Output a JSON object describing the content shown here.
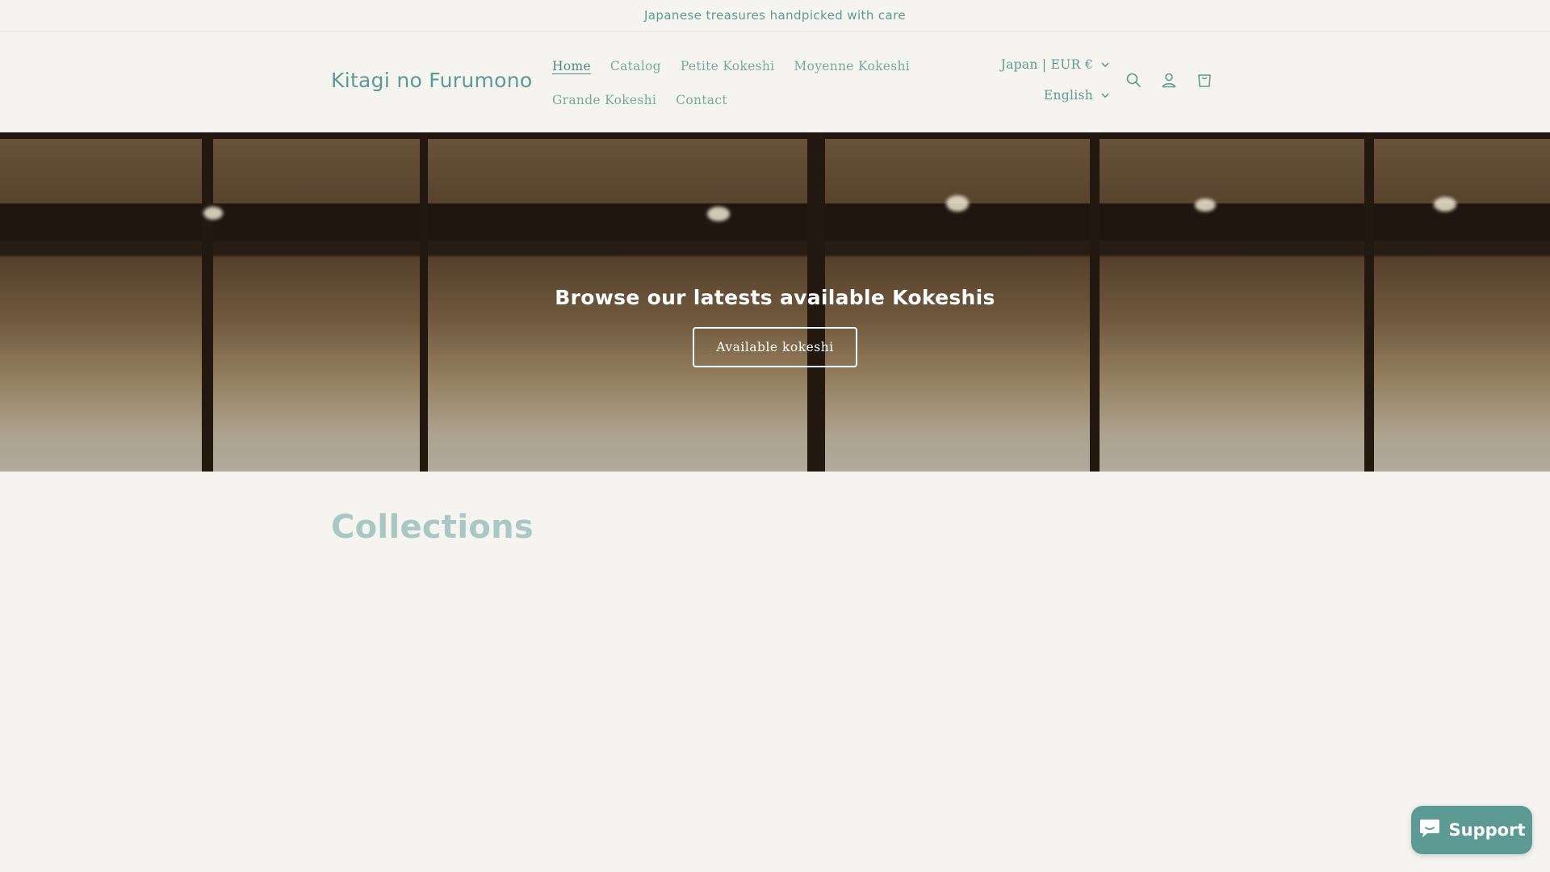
{
  "announcement": {
    "text": "Japanese treasures handpicked with care"
  },
  "header": {
    "logo": "Kitagi no Furumono",
    "nav": [
      {
        "label": "Home",
        "active": true
      },
      {
        "label": "Catalog",
        "active": false
      },
      {
        "label": "Petite Kokeshi",
        "active": false
      },
      {
        "label": "Moyenne Kokeshi",
        "active": false
      },
      {
        "label": "Grande Kokeshi",
        "active": false
      },
      {
        "label": "Contact",
        "active": false
      }
    ],
    "country_selector": "Japan | EUR €",
    "language_selector": "English",
    "icons": {
      "search": "search-icon",
      "account": "account-icon",
      "cart": "cart-icon"
    }
  },
  "hero": {
    "title": "Browse our latests available Kokeshis",
    "button_label": "Available kokeshi"
  },
  "collections": {
    "title": "Collections"
  },
  "support_widget": {
    "label": "Support",
    "icon": "chat-icon"
  },
  "colors": {
    "accent": "#5e9a94",
    "background": "#f5f4f0",
    "muted_heading": "#a9c7c3"
  }
}
